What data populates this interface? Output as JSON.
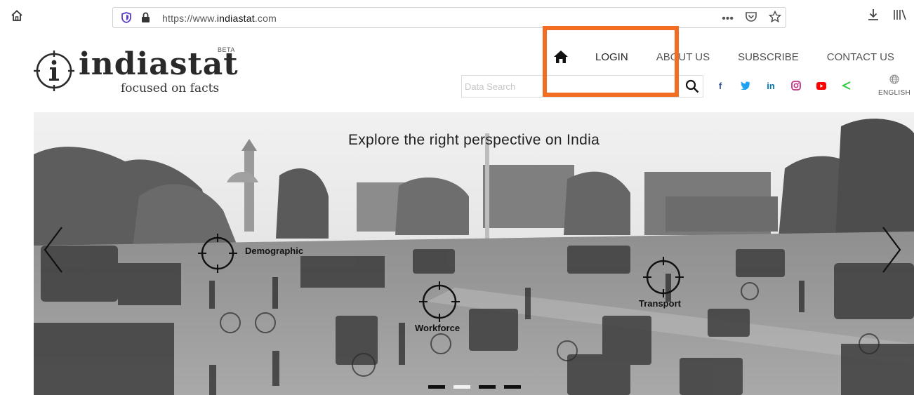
{
  "browser": {
    "url_prefix": "https://www.",
    "url_domain": "indiastat",
    "url_suffix": ".com",
    "actions": [
      "•••",
      "♡",
      "☆"
    ],
    "download_icon": "download-icon",
    "library_icon": "library-icon"
  },
  "header": {
    "logo_word": "indiastat",
    "logo_beta": "BETA",
    "logo_tagline": "focused on facts",
    "nav": {
      "login": "LOGIN",
      "about": "ABOUT US",
      "subscribe": "SUBSCRIBE",
      "contact": "CONTACT US"
    },
    "search": {
      "placeholder": "Data Search"
    },
    "socials": [
      "facebook-icon",
      "twitter-icon",
      "linkedin-icon",
      "instagram-icon",
      "youtube-icon",
      "share-icon"
    ],
    "language": "ENGLISH"
  },
  "hero": {
    "title": "Explore the right perspective on India",
    "markers": {
      "demographic": "Demographic",
      "workforce": "Workforce",
      "transport": "Transport"
    },
    "slide_count": 4,
    "active_slide": 2
  },
  "colors": {
    "highlight": "#f26c21",
    "facebook": "#3b5998",
    "twitter": "#1da1f2",
    "linkedin": "#0077b5",
    "instagram": "#c13584",
    "youtube": "#ff0000",
    "share": "#2ecc40"
  }
}
